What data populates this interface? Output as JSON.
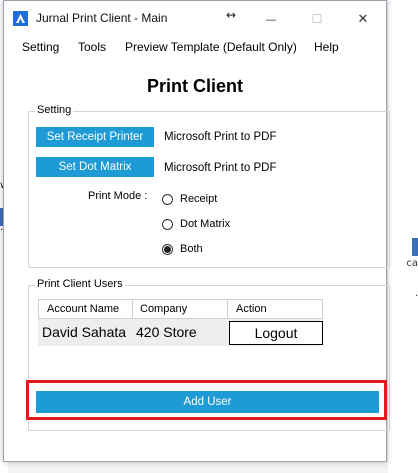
{
  "window": {
    "title": "Jurnal Print Client - Main",
    "resize_glyph": "↔",
    "minimize_glyph": "—",
    "maximize_glyph": "☐",
    "close_glyph": "✕"
  },
  "menu": {
    "items": [
      {
        "label": "Setting"
      },
      {
        "label": "Tools"
      },
      {
        "label": "Preview Template (Default Only)"
      },
      {
        "label": "Help"
      }
    ]
  },
  "main": {
    "title": "Print Client"
  },
  "setting": {
    "group_label": "Setting",
    "receipt_printer_button": "Set Receipt Printer",
    "receipt_printer_value": "Microsoft Print to PDF",
    "dot_matrix_button": "Set Dot Matrix",
    "dot_matrix_value": "Microsoft Print to PDF",
    "print_mode_label": "Print Mode :",
    "print_modes": [
      {
        "label": "Receipt",
        "selected": false
      },
      {
        "label": "Dot Matrix",
        "selected": false
      },
      {
        "label": "Both",
        "selected": true
      }
    ]
  },
  "users": {
    "group_label": "Print Client Users",
    "columns": [
      "Account Name",
      "Company",
      "Action"
    ],
    "rows": [
      {
        "account_name": "David Sahata",
        "company": "420 Store",
        "action": "Logout"
      }
    ],
    "add_user_button": "Add User"
  },
  "colors": {
    "accent": "#1e9ad6",
    "highlight": "#e3191e",
    "app_icon": "#1e6fd9"
  },
  "background_fragments": {
    "left": [
      "w",
      "."
    ],
    "right": [
      "ca",
      "."
    ]
  }
}
